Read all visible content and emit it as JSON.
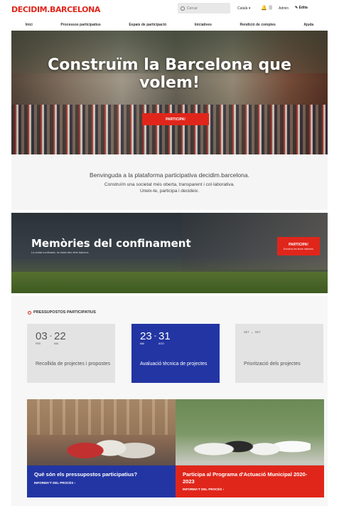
{
  "header": {
    "logo": "DECIDIM.BARCELONA",
    "search_placeholder": "Cercar",
    "language": "Català ▾",
    "admin": "Admin",
    "edit": "Edita"
  },
  "nav": [
    "Inici",
    "Processos participatius",
    "Espais de participació",
    "Iniciatives",
    "Rendició de comptes",
    "Ajuda"
  ],
  "hero": {
    "title_line1": "Construïm la Barcelona que",
    "title_line2": "volem!",
    "button": "PARTICIPA!"
  },
  "welcome": {
    "line1": "Benvinguda a la plataforma participativa decidim.barcelona.",
    "line2": "Construïm una societat més oberta, transparent i col·laborativa.",
    "line3": "Uneix-te, participa i decideix."
  },
  "banner": {
    "title": "Memòries del confinament",
    "subtitle": "La ciutat confinada, la ciutat des dels balcons",
    "button_line1": "PARTICIPA!",
    "button_line2": "Envia'ns les teves històries"
  },
  "budget": {
    "tag": "PRESSUPOSTOS PARTICIPATIUS",
    "phases": [
      {
        "start_day": "03",
        "start_month": "FEB",
        "end_day": "22",
        "end_month": "MAI",
        "label": "Recollida de projectes i propostes"
      },
      {
        "start_day": "23",
        "start_month": "MAI",
        "end_day": "31",
        "end_month": "AGO",
        "label": "Avaluació tècnica de projectes"
      },
      {
        "start_day": "SET",
        "start_month": "",
        "end_day": "SET",
        "end_month": "",
        "label": "Priorització dels projectes"
      }
    ],
    "cards": [
      {
        "title": "Què són els pressupostos participatius?",
        "link": "INFORMA'T DEL PROCÉS ›"
      },
      {
        "title": "Participa al Programa d'Actuació Municipal 2020-2023",
        "link": "INFORMA'T DEL PROCÉS ›"
      }
    ]
  },
  "colors": {
    "brand_red": "#e0261b",
    "brand_blue": "#2335a3"
  }
}
